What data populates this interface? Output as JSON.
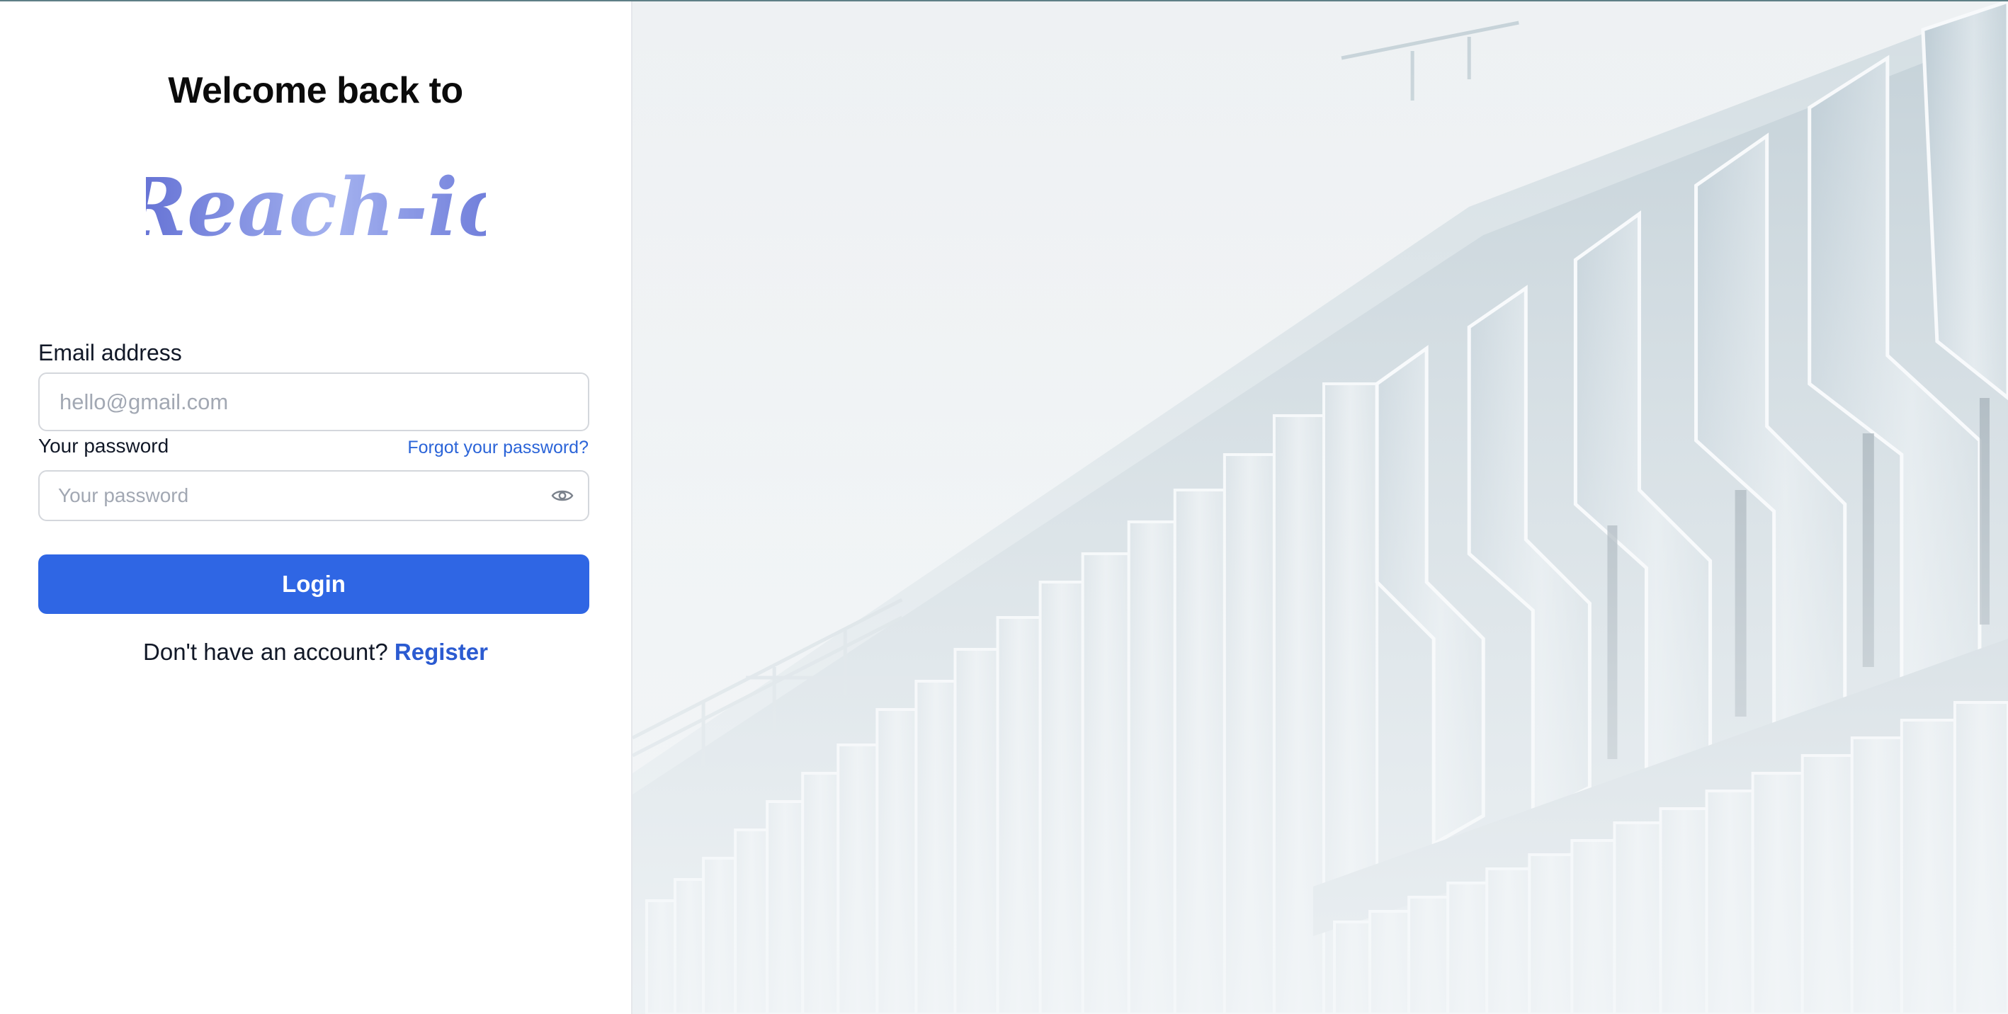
{
  "header": {
    "welcome_text": "Welcome back to",
    "brand_name": "Reach-io"
  },
  "form": {
    "email": {
      "label": "Email address",
      "value": "",
      "placeholder": "hello@gmail.com"
    },
    "password": {
      "label": "Your password",
      "value": "",
      "placeholder": "Your password",
      "forgot_link": "Forgot your password?",
      "toggle_icon": "eye-icon"
    },
    "login_button": "Login",
    "register_prompt": "Don't have an account?",
    "register_link": "Register"
  },
  "hero_image": {
    "subject": "white modern building facade with angled vertical fins"
  },
  "colors": {
    "primary": "#2f66e4",
    "link": "#2b64d8",
    "brand_gradient_start": "#5f6cd2",
    "brand_gradient_end": "#a9b7f0"
  }
}
